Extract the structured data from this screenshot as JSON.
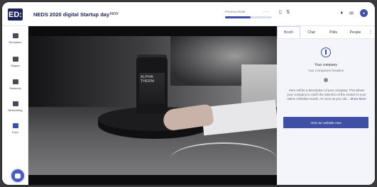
{
  "header": {
    "logo_text": "ED:",
    "event_title": "NEDS 2020 digital Startup day",
    "event_date": "NOV",
    "preview_label": "Preview Mode",
    "preview_label_right": "——",
    "preview_progress": 0.55
  },
  "sidebar": {
    "items": [
      {
        "label": "Reception",
        "icon": "home-icon"
      },
      {
        "label": "Stages",
        "icon": "video-icon"
      },
      {
        "label": "Sessions",
        "icon": "sessions-icon"
      },
      {
        "label": "Networking",
        "icon": "networking-icon"
      },
      {
        "label": "Expo",
        "icon": "expo-icon",
        "active": true
      }
    ]
  },
  "video": {
    "jar_label": "ALPHA THERM"
  },
  "panel": {
    "tabs": [
      "Booth",
      "Chat",
      "Polls",
      "People"
    ],
    "more": "⋮",
    "company_name": "Your company",
    "company_headline": "Your companies headline",
    "description": "Here will be a description of your company. This allows your company to catch the attention of the visitors to your online exhibition booth. As soon as you cab... ",
    "show_more": "Show More",
    "website_button": "Visit our website now"
  },
  "colors": {
    "brand": "#1f2357",
    "accent": "#3f4fa3"
  }
}
